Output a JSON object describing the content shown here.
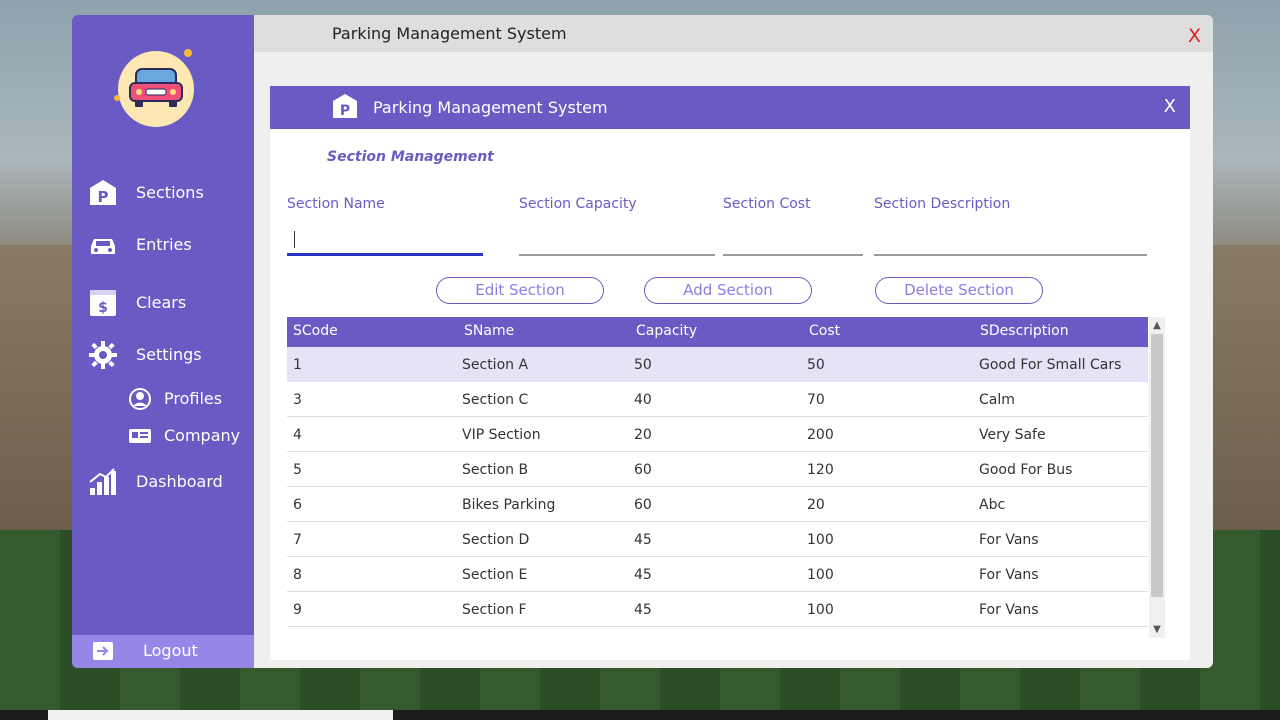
{
  "window": {
    "title": "Parking Management System",
    "close_label": "X"
  },
  "sidebar": {
    "items": [
      {
        "label": "Sections",
        "icon": "parking-icon"
      },
      {
        "label": "Entries",
        "icon": "car-icon"
      },
      {
        "label": "Clears",
        "icon": "dollar-bill-icon"
      },
      {
        "label": "Settings",
        "icon": "gear-icon"
      }
    ],
    "sub_items": [
      {
        "label": "Profiles",
        "icon": "user-icon"
      },
      {
        "label": "Company",
        "icon": "id-card-icon"
      }
    ],
    "dashboard_label": "Dashboard",
    "logout_label": "Logout"
  },
  "dialog": {
    "title": "Parking Management System",
    "close_label": "X",
    "heading": "Section Management",
    "fields": {
      "name_label": "Section Name",
      "name_value": "",
      "capacity_label": "Section Capacity",
      "capacity_value": "",
      "cost_label": "Section Cost",
      "cost_value": "",
      "description_label": "Section Description",
      "description_value": ""
    },
    "buttons": {
      "edit": "Edit Section",
      "add": "Add Section",
      "delete": "Delete Section"
    }
  },
  "table": {
    "columns": [
      "SCode",
      "SName",
      "Capacity",
      "Cost",
      "SDescription"
    ],
    "rows": [
      [
        "1",
        "Section A",
        "50",
        "50",
        "Good For Small Cars"
      ],
      [
        "3",
        "Section C",
        "40",
        "70",
        "Calm"
      ],
      [
        "4",
        "VIP Section",
        "20",
        "200",
        "Very Safe"
      ],
      [
        "5",
        "Section B",
        "60",
        "120",
        "Good For Bus"
      ],
      [
        "6",
        "Bikes Parking",
        "60",
        "20",
        "Abc"
      ],
      [
        "7",
        "Section D",
        "45",
        "100",
        "For Vans"
      ],
      [
        "8",
        "Section E",
        "45",
        "100",
        "For Vans"
      ],
      [
        "9",
        "Section F",
        "45",
        "100",
        "For Vans"
      ]
    ],
    "selected_row": 0
  },
  "colors": {
    "accent": "#6a5bc4",
    "selected_row": "#e6e3f9",
    "close_red": "#e02020"
  }
}
